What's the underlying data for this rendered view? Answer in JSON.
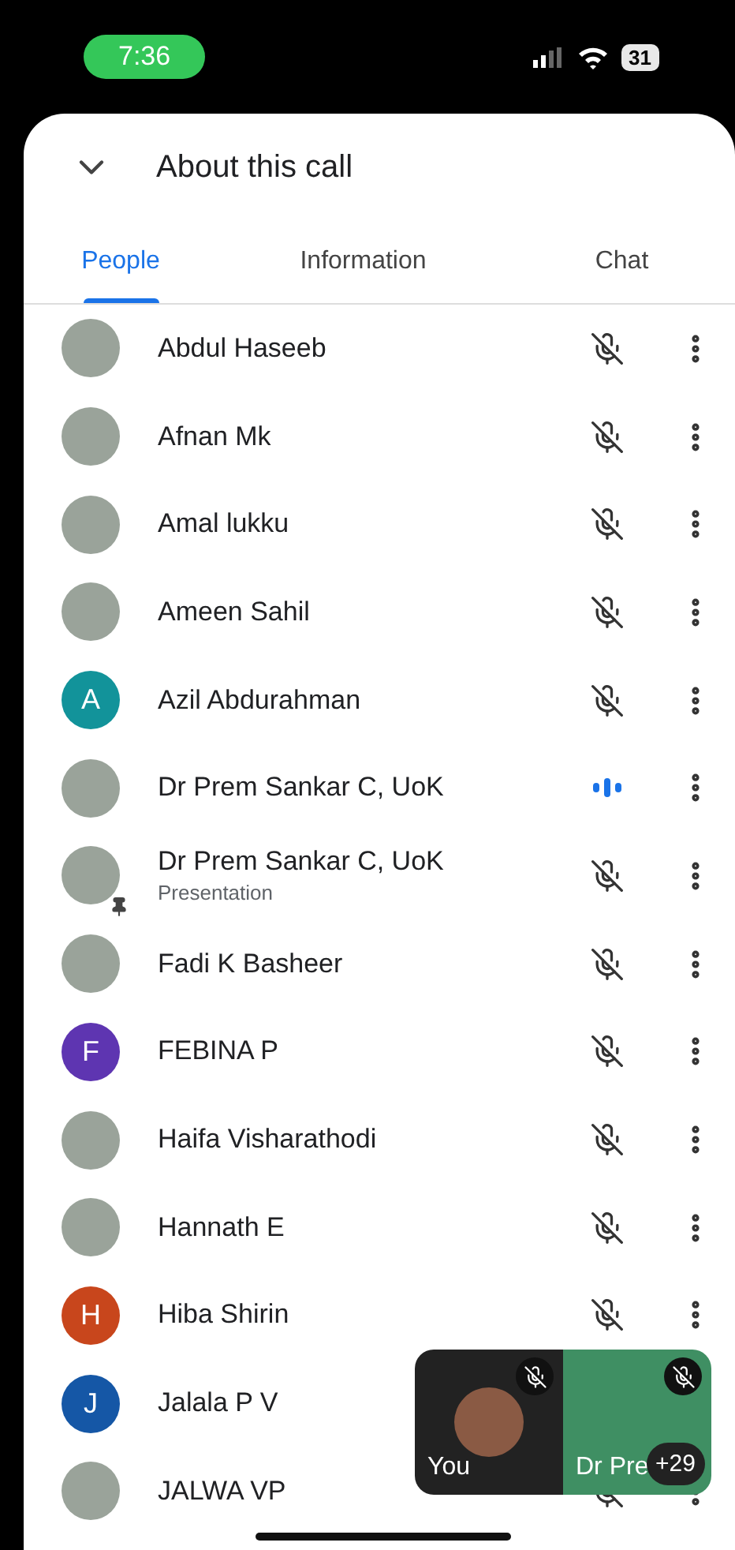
{
  "status_bar": {
    "time": "7:36",
    "battery": "31"
  },
  "header": {
    "title": "About this call"
  },
  "tabs": [
    {
      "label": "People",
      "selected": true
    },
    {
      "label": "Information",
      "selected": false
    },
    {
      "label": "Chat",
      "selected": false
    }
  ],
  "participants": [
    {
      "name": "Abdul Haseeb",
      "kind": "photo",
      "speaking": false,
      "pinned": false
    },
    {
      "name": "Afnan Mk",
      "kind": "photo",
      "speaking": false,
      "pinned": false
    },
    {
      "name": "Amal lukku",
      "kind": "photo",
      "speaking": false,
      "pinned": false
    },
    {
      "name": "Ameen Sahil",
      "kind": "photo",
      "speaking": false,
      "pinned": false
    },
    {
      "name": "Azil Abdurahman",
      "kind": "letter",
      "initial": "A",
      "color": "#12939a",
      "speaking": false,
      "pinned": false
    },
    {
      "name": "Dr Prem Sankar C, UoK",
      "kind": "photo",
      "speaking": true,
      "pinned": false
    },
    {
      "name": "Dr Prem Sankar C, UoK",
      "subtitle": "Presentation",
      "kind": "photo",
      "speaking": false,
      "pinned": true
    },
    {
      "name": "Fadi K Basheer",
      "kind": "photo",
      "speaking": false,
      "pinned": false
    },
    {
      "name": "FEBINA P",
      "kind": "letter",
      "initial": "F",
      "color": "#5e35b1",
      "speaking": false,
      "pinned": false
    },
    {
      "name": "Haifa Visharathodi",
      "kind": "photo",
      "speaking": false,
      "pinned": false
    },
    {
      "name": "Hannath E",
      "kind": "photo",
      "speaking": false,
      "pinned": false
    },
    {
      "name": "Hiba Shirin",
      "kind": "letter",
      "initial": "H",
      "color": "#c8461c",
      "speaking": false,
      "pinned": false
    },
    {
      "name": "Jalala P V",
      "kind": "letter",
      "initial": "J",
      "color": "#1557a6",
      "speaking": false,
      "pinned": false
    },
    {
      "name": "JALWA VP",
      "kind": "photo",
      "speaking": false,
      "pinned": false
    }
  ],
  "floating_window": {
    "tiles": [
      {
        "label": "You",
        "kind": "self"
      },
      {
        "label": "Dr Pre",
        "kind": "presentation"
      }
    ],
    "more_count": "+29"
  }
}
